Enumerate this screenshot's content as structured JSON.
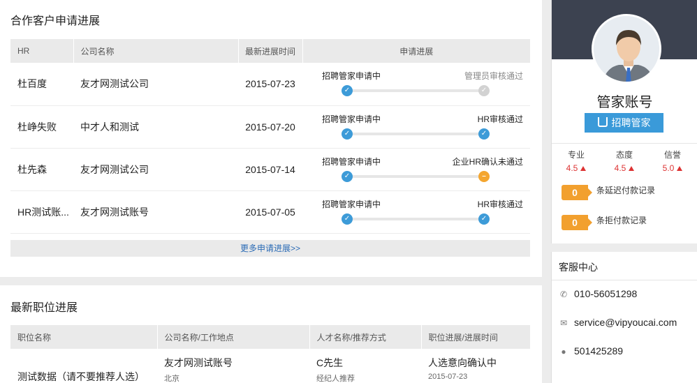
{
  "partner": {
    "title": "合作客户申请进展",
    "headers": [
      "HR",
      "公司名称",
      "最新进展时间",
      "申请进展"
    ],
    "rows": [
      {
        "hr": "杜百度",
        "company": "友才网测试公司",
        "date": "2015-07-23",
        "left_step": "招聘管家申请中",
        "right_step": "管理员审核通过",
        "right_state": "pending"
      },
      {
        "hr": "杜峥失败",
        "company": "中才人和测试",
        "date": "2015-07-20",
        "left_step": "招聘管家申请中",
        "right_step": "HR审核通过",
        "right_state": "done"
      },
      {
        "hr": "杜先森",
        "company": "友才网测试公司",
        "date": "2015-07-14",
        "left_step": "招聘管家申请中",
        "right_step": "企业HR确认未通过",
        "right_state": "rejected"
      },
      {
        "hr": "HR测试账...",
        "company": "友才网测试账号",
        "date": "2015-07-05",
        "left_step": "招聘管家申请中",
        "right_step": "HR审核通过",
        "right_state": "done"
      }
    ],
    "more_link": "更多申请进展>>"
  },
  "jobs": {
    "title": "最新职位进展",
    "headers": [
      "职位名称",
      "公司名称/工作地点",
      "人才名称/推荐方式",
      "职位进展/进展时间"
    ],
    "rows": [
      {
        "job": "测试数据（请不要推荐人选）",
        "company": "友才网测试账号",
        "location": "北京",
        "talent": "C先生",
        "method": "经纪人推荐",
        "status": "人选意向确认中",
        "time": "2015-07-23"
      }
    ]
  },
  "profile": {
    "name": "管家账号",
    "button": "招聘管家",
    "ratings": [
      {
        "label": "专业",
        "value": "4.5"
      },
      {
        "label": "态度",
        "value": "4.5"
      },
      {
        "label": "信誉",
        "value": "5.0"
      }
    ],
    "records": [
      {
        "count": "0",
        "label": "条延迟付款记录"
      },
      {
        "count": "0",
        "label": "条拒付款记录"
      }
    ],
    "colors": {
      "accent": "#3a9ad9",
      "badge": "#f2a02e",
      "rating": "#dd3333",
      "banner": "#3c4250"
    }
  },
  "service": {
    "title": "客服中心",
    "phone": "010-56051298",
    "email": "service@vipyoucai.com",
    "qq": "501425289",
    "icons": [
      "phone-icon",
      "mail-icon",
      "qq-icon"
    ]
  }
}
